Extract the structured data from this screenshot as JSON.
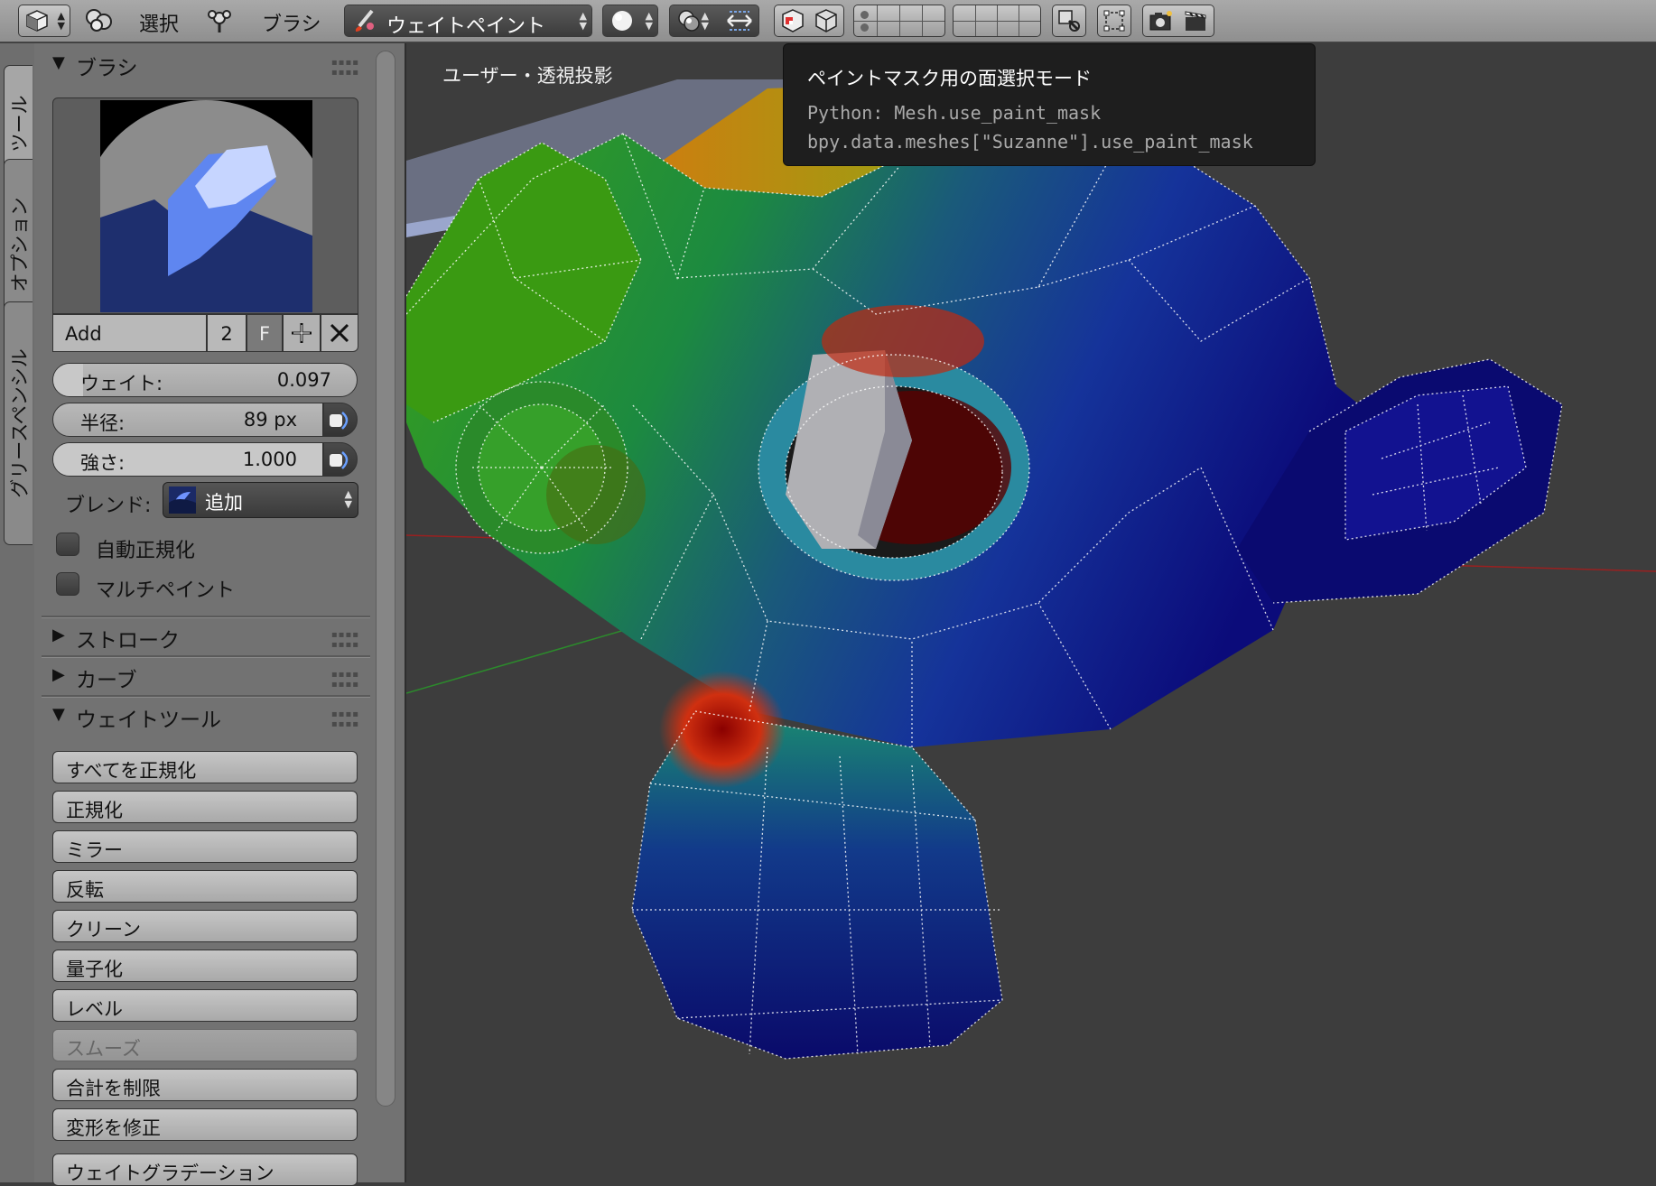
{
  "header": {
    "menu_select": "選択",
    "menu_brush": "ブラシ",
    "mode_label": "ウェイトペイント"
  },
  "tabs": [
    "ツール",
    "オプション",
    "グリースペンシル"
  ],
  "brush_panel": {
    "title": "ブラシ",
    "name_field": "Add",
    "users": "2",
    "fake_user": "F",
    "weight": {
      "label": "ウェイト:",
      "value": "0.097",
      "fraction": 0.097
    },
    "radius": {
      "label": "半径:",
      "value": "89 px"
    },
    "strength": {
      "label": "強さ:",
      "value": "1.000",
      "fraction": 1.0
    },
    "blend": {
      "label": "ブレンド:",
      "value": "追加"
    },
    "auto_normalize": {
      "label": "自動正規化",
      "checked": false
    },
    "multi_paint": {
      "label": "マルチペイント",
      "checked": false
    }
  },
  "collapsed_panels": [
    "ストローク",
    "カーブ"
  ],
  "weight_tools": {
    "title": "ウェイトツール",
    "buttons": [
      "すべてを正規化",
      "正規化",
      "ミラー",
      "反転",
      "クリーン",
      "量子化",
      "レベル",
      "スムーズ",
      "合計を制限",
      "変形を修正",
      "ウェイトグラデーション"
    ],
    "disabled": [
      "スムーズ"
    ]
  },
  "viewport": {
    "label": "ユーザー・透視投影"
  },
  "tooltip": {
    "title": "ペイントマスク用の面選択モード",
    "python": "Python: Mesh.use_paint_mask",
    "path": "bpy.data.meshes[\"Suzanne\"].use_paint_mask"
  },
  "colors": {
    "header_bg": "#9c9c9c",
    "panel_bg": "#727272",
    "viewport_bg": "#3d3d3d",
    "tooltip_bg": "#1e1e1e",
    "weight_high": "#c00000",
    "weight_low": "#0a0a7a"
  }
}
